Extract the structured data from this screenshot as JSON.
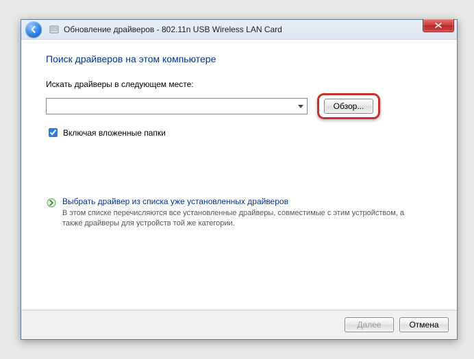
{
  "titlebar": {
    "title": "Обновление драйверов - 802.11n USB Wireless LAN Card"
  },
  "content": {
    "heading": "Поиск драйверов на этом компьютере",
    "path_label": "Искать драйверы в следующем месте:",
    "path_value": "",
    "browse_label": "Обзор...",
    "include_subfolders_label": "Включая вложенные папки",
    "include_subfolders_checked": true,
    "link": {
      "title": "Выбрать драйвер из списка уже установленных драйверов",
      "desc": "В этом списке перечисляются все установленные драйверы, совместимые с этим устройством, а также драйверы для устройств той же категории."
    }
  },
  "footer": {
    "next_label": "Далее",
    "cancel_label": "Отмена"
  }
}
